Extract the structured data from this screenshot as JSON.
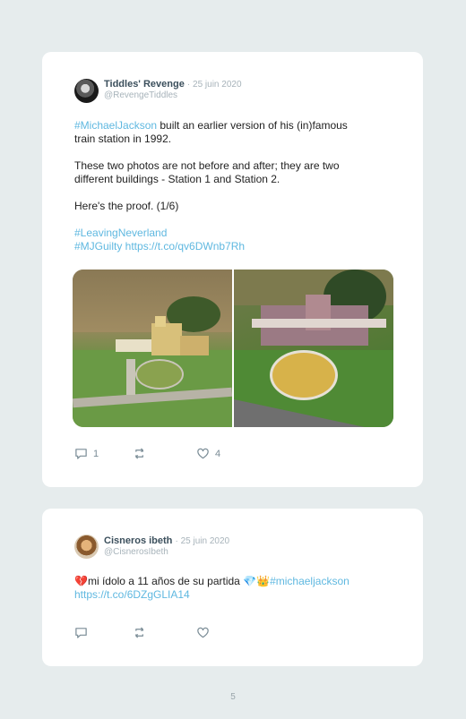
{
  "tweets": [
    {
      "name": "Tiddles' Revenge",
      "date": "· 25 juin 2020",
      "handle": "@RevengeTiddles",
      "hashtag_mj": "#MichaelJackson",
      "line1_rest": " built an earlier version of his (in)famous",
      "line2": "train station in 1992.",
      "para2_line1": "These two photos are not before and after; they are two",
      "para2_line2": "different buildings - Station 1 and Station 2.",
      "para3": "Here's the proof. (1/6)",
      "hashtag_ln": "#LeavingNeverland",
      "hashtag_mjg": "#MJGuilty",
      "link": " https://t.co/qv6DWnb7Rh",
      "reply_count": "1",
      "like_count": "4"
    },
    {
      "name": "Cisneros ibeth",
      "date": "· 25 juin 2020",
      "handle": "@CisnerosIbeth",
      "emoji_heart": "💔",
      "text": "mi ídolo a 11 años de su partida ",
      "emoji_end": "💎👑",
      "hashtag": "#michaeljackson",
      "link": "https://t.co/6DZgGLIA14"
    }
  ],
  "page_number": "5"
}
